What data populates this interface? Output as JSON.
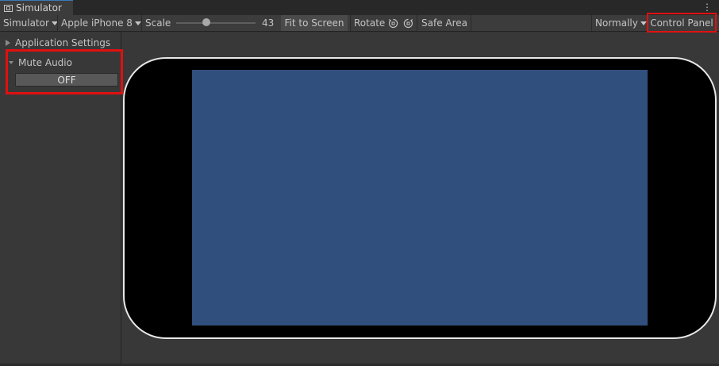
{
  "window": {
    "tab_title": "Simulator",
    "menu_icon": "kebab-icon"
  },
  "toolbar": {
    "mode_label": "Simulator",
    "device_label": "Apple iPhone 8",
    "scale_label": "Scale",
    "scale_value": "43",
    "scale_fraction": 0.43,
    "fit_label": "Fit to Screen",
    "rotate_label": "Rotate",
    "safe_area_label": "Safe Area",
    "normally_label": "Normally",
    "control_panel_label": "Control Panel"
  },
  "panel": {
    "app_settings_label": "Application Settings",
    "mute_audio_label": "Mute Audio",
    "mute_value": "OFF"
  },
  "colors": {
    "screen": "#304f7d",
    "highlight": "#e01010",
    "tab_accent": "#3a79bb"
  }
}
